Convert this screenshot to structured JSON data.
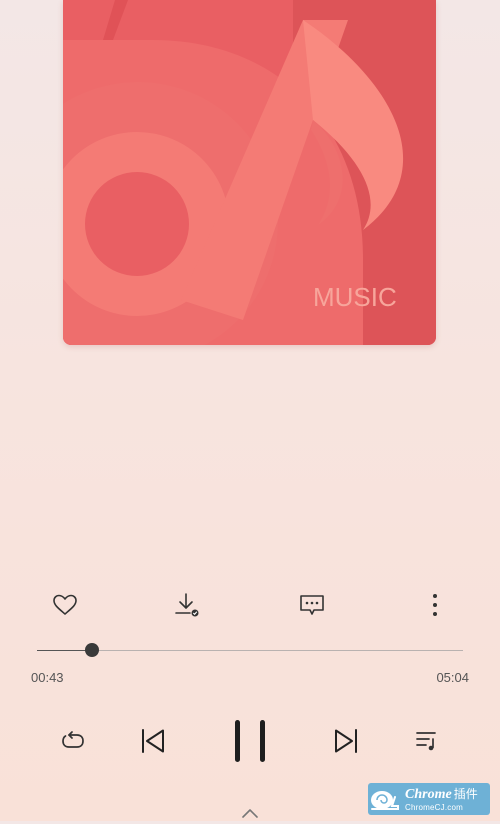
{
  "album_art": {
    "label": "MUSIC",
    "colors": {
      "base": "#ec6a6b",
      "note": "#f9857e"
    }
  },
  "actions": [
    {
      "name": "like-button",
      "icon": "heart-icon"
    },
    {
      "name": "download-button",
      "icon": "download-icon"
    },
    {
      "name": "comment-button",
      "icon": "comment-icon"
    },
    {
      "name": "more-button",
      "icon": "more-vertical-icon"
    }
  ],
  "player": {
    "current_time": "00:43",
    "total_time": "05:04",
    "progress": 0.13
  },
  "controls": [
    {
      "name": "repeat-button",
      "icon": "repeat-icon"
    },
    {
      "name": "previous-button",
      "icon": "skip-previous-icon"
    },
    {
      "name": "pause-button",
      "icon": "pause-icon"
    },
    {
      "name": "next-button",
      "icon": "skip-next-icon"
    },
    {
      "name": "playlist-button",
      "icon": "playlist-icon"
    }
  ],
  "watermark": {
    "main": "Chrome",
    "cjk": "插件",
    "sub": "ChromeCJ.com",
    "color": "#6eb1d6"
  },
  "expand": {
    "icon": "chevron-up-icon"
  }
}
